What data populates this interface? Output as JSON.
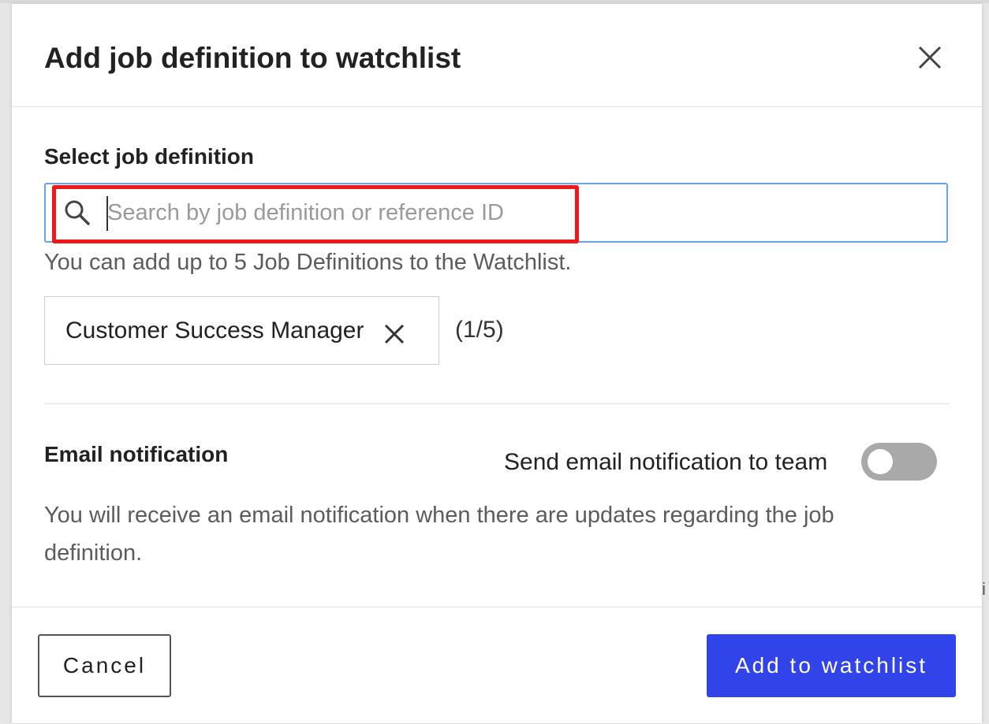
{
  "modal": {
    "title": "Add job definition to watchlist"
  },
  "job_select": {
    "label": "Select job definition",
    "search_placeholder": "Search by job definition or reference ID",
    "search_value": "",
    "helper_text": "You can add up to 5 Job Definitions to the Watchlist.",
    "selected": [
      {
        "label": "Customer Success Manager"
      }
    ],
    "count_text": "(1/5)"
  },
  "email_notification": {
    "label": "Email notification",
    "toggle_label": "Send email notification to team",
    "toggle_on": false,
    "description": "You will receive an email notification when there are updates regarding the job definition."
  },
  "footer": {
    "cancel_label": "Cancel",
    "submit_label": "Add to watchlist"
  },
  "colors": {
    "primary": "#3044ea",
    "highlight": "#f01919",
    "focus_border": "#6aa2e8",
    "toggle_off": "#a9a9a9"
  },
  "backdrop": {
    "peek_char": "i"
  }
}
